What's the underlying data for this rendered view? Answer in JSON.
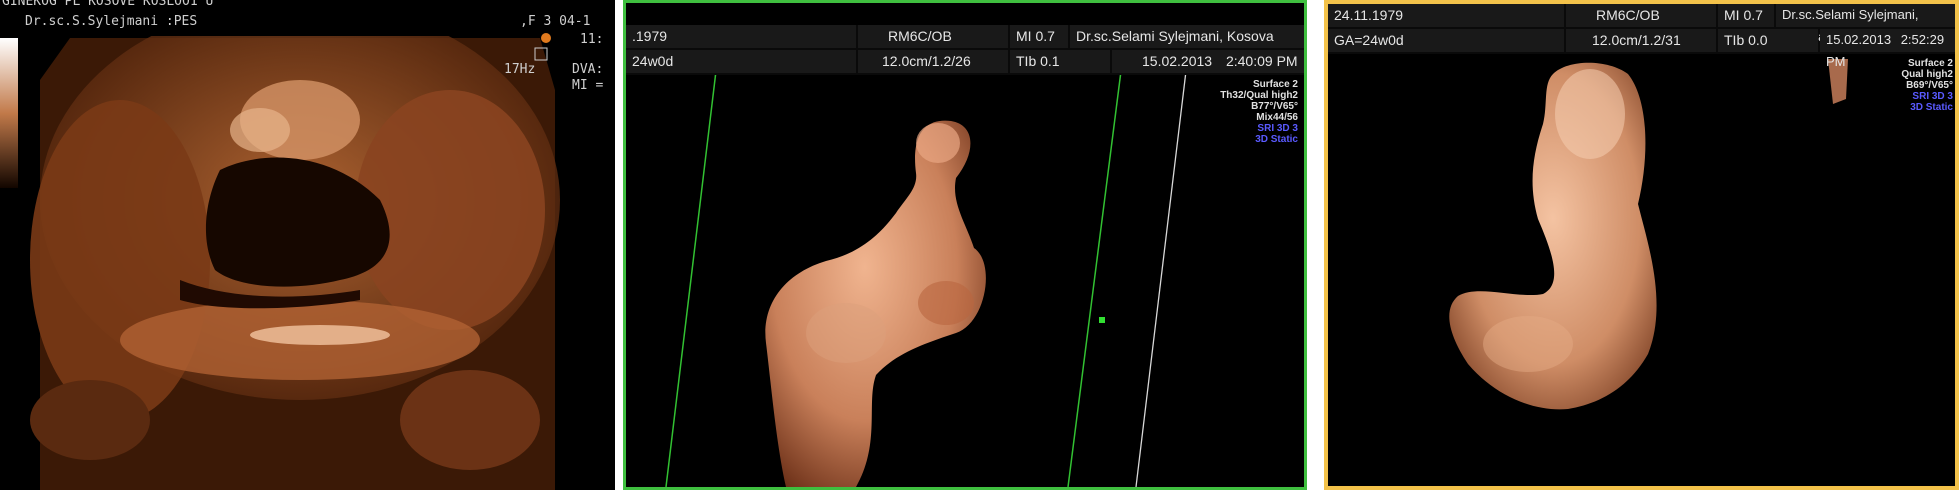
{
  "panel1": {
    "header_line1": "GINEKOG  PL  KOSOVE  KOSLOO1 U",
    "header_line1b": ",F 3  04-1",
    "header_line1c": "11:",
    "patient_line": "Dr.sc.S.Sylejmani    :PES",
    "frequency": "17Hz",
    "dva_label": "DVA:",
    "mi_label": "MI ="
  },
  "panel2": {
    "header": {
      "dob": ".1979",
      "probe": "RM6C/OB",
      "mi": "MI  0.7",
      "doctor": "Dr.sc.Selami Sylejmani, Kosova",
      "ga": "24w0d",
      "depth": "12.0cm/1.2/26",
      "tib": "TIb  0.1",
      "date": "15.02.2013",
      "time": "2:40:09 PM"
    },
    "side_labels": [
      "Surface 2",
      "Th32/Qual high2",
      "B77°/V65°",
      "Mix44/56",
      "SRI 3D 3",
      "3D Static"
    ]
  },
  "panel3": {
    "header": {
      "dob": "24.11.1979",
      "probe": "RM6C/OB",
      "mi": "MI  0.7",
      "doctor": "Dr.sc.Selami Sylejmani, Kosova",
      "ga": "GA=24w0d",
      "depth": "12.0cm/1.2/31",
      "tib": "TIb  0.0",
      "date": "15.02.2013",
      "time": "2:52:29 PM"
    },
    "side_labels": [
      "Surface 2",
      "Qual high2",
      "B69°/V65°",
      "SRI 3D 3",
      "3D Static"
    ]
  },
  "colors": {
    "panel2_border": "#3fbf3f",
    "panel3_border": "#f3c24a",
    "ultrasound_copper": "#b5652f",
    "skin_tone": "#d9926b",
    "sri_label_blue": "#5a5aff"
  }
}
